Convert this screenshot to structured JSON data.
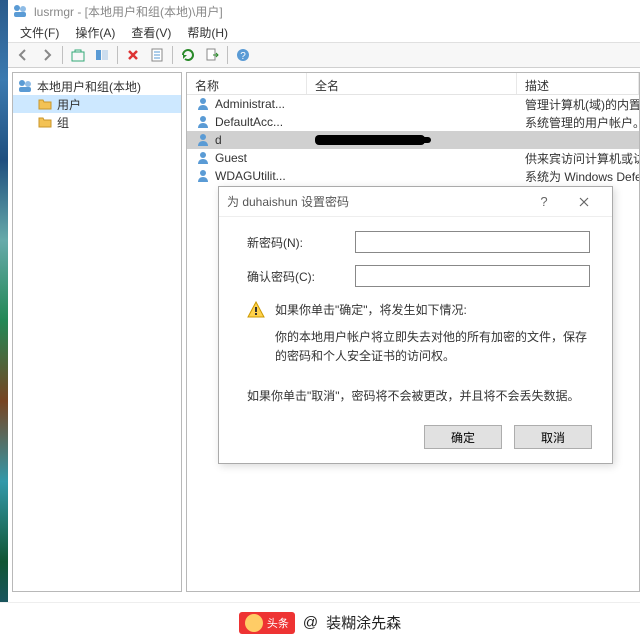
{
  "title": "lusrmgr - [本地用户和组(本地)\\用户]",
  "menu": {
    "file": "文件(F)",
    "action": "操作(A)",
    "view": "查看(V)",
    "help": "帮助(H)"
  },
  "tree": {
    "root": "本地用户和组(本地)",
    "children": [
      {
        "label": "用户",
        "selected": true
      },
      {
        "label": "组",
        "selected": false
      }
    ]
  },
  "list": {
    "headers": {
      "name": "名称",
      "fullname": "全名",
      "desc": "描述"
    },
    "rows": [
      {
        "name": "Administrat...",
        "fullname": "",
        "desc": "管理计算机(域)的内置帐户"
      },
      {
        "name": "DefaultAcc...",
        "fullname": "",
        "desc": "系统管理的用户帐户。"
      },
      {
        "name": "d",
        "fullname": "",
        "desc": "",
        "redacted": true,
        "selected": true
      },
      {
        "name": "Guest",
        "fullname": "",
        "desc": "供来宾访问计算机或访问域的内..."
      },
      {
        "name": "WDAGUtilit...",
        "fullname": "",
        "desc": "系统为 Windows Defender 应用..."
      }
    ]
  },
  "dialog": {
    "title": "为 duhaishun 设置密码",
    "new_pwd_label": "新密码(N):",
    "confirm_pwd_label": "确认密码(C):",
    "new_pwd_value": "",
    "confirm_pwd_value": "",
    "warn_line1": "如果你单击\"确定\"，将发生如下情况:",
    "warn_line2": "你的本地用户帐户将立即失去对他的所有加密的文件，保存的密码和个人安全证书的访问权。",
    "note": "如果你单击\"取消\"，密码将不会被更改，并且将不会丢失数据。",
    "ok": "确定",
    "cancel": "取消"
  },
  "watermark": {
    "badge": "头条",
    "at": "@",
    "author": "装糊涂先森"
  }
}
